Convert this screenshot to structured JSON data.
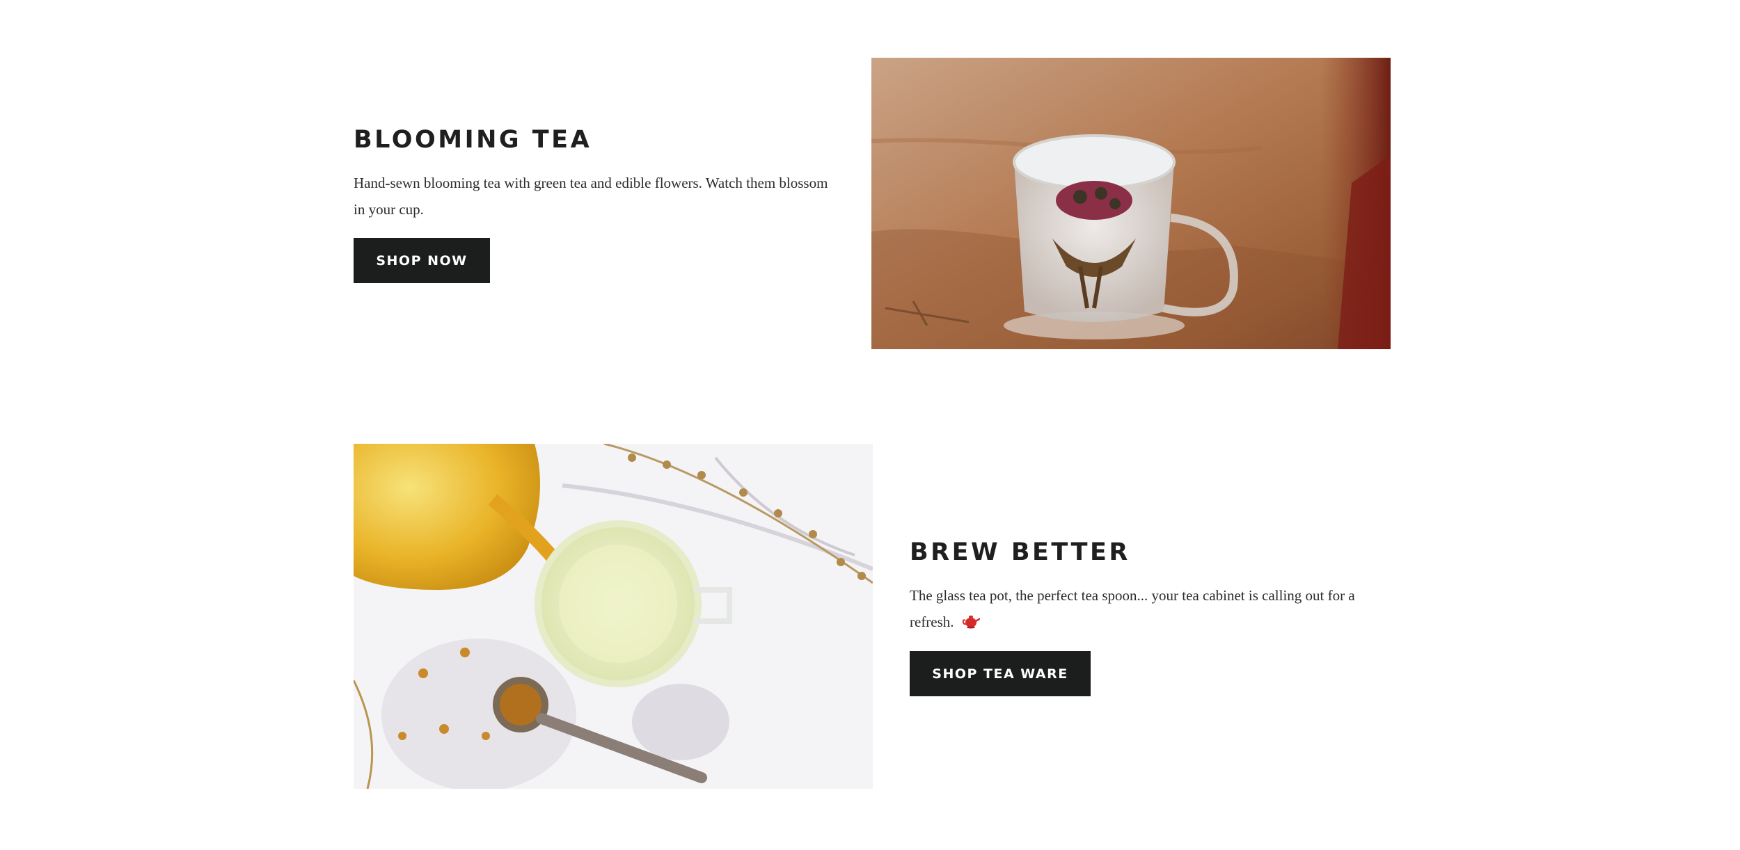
{
  "sections": [
    {
      "title": "BLOOMING TEA",
      "description": "Hand-sewn blooming tea with green tea and edible flowers. Watch them blossom in your cup.",
      "button_label": "SHOP NOW",
      "image_alt": "glass-cup-blooming-tea-photo"
    },
    {
      "title": "BREW BETTER",
      "description": "The glass tea pot, the perfect tea spoon... your tea cabinet is calling out for a refresh.",
      "emoji_icon": "teapot-emoji",
      "button_label": "SHOP TEA WARE",
      "image_alt": "glass-teapot-pouring-tea-photo"
    }
  ],
  "colors": {
    "button_bg": "#1c1d1d",
    "button_text": "#ffffff",
    "heading": "#1f1f1f",
    "body_text": "#2c2c2c",
    "background": "#ffffff"
  }
}
